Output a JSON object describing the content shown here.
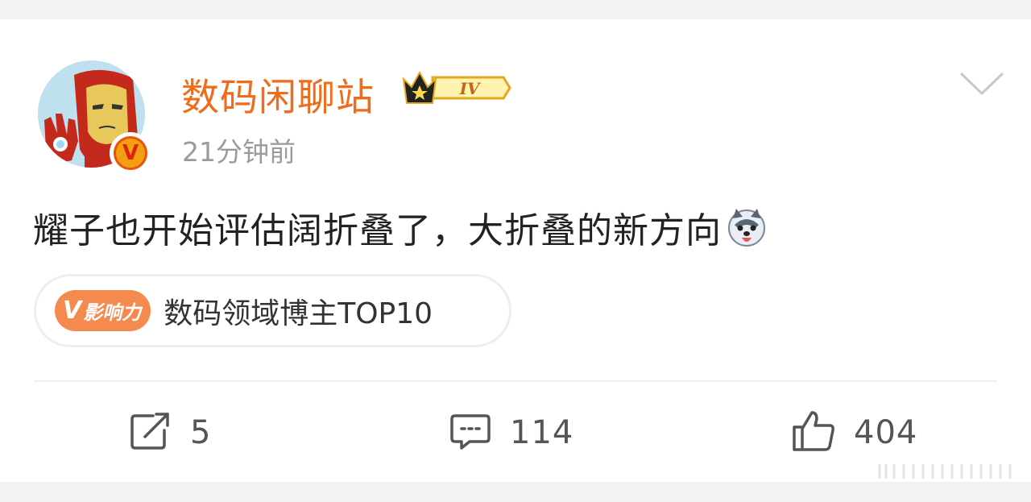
{
  "post": {
    "username": "数码闲聊站",
    "level": "IV",
    "timestamp": "21分钟前",
    "content": "耀子也开始评估阔折叠了，大折叠的新方向",
    "verified_mark": "V"
  },
  "influence": {
    "badge_letter": "V",
    "badge_text": "影响力",
    "label": "数码领域博主TOP10"
  },
  "actions": {
    "repost_count": "5",
    "comment_count": "114",
    "like_count": "404"
  },
  "icons": {
    "menu": "chevron-down-icon",
    "repost": "share-icon",
    "comment": "comment-icon",
    "like": "thumbs-up-icon",
    "emoji": "husky-emoji"
  },
  "colors": {
    "username": "#f06b1a",
    "badge": "#f58a4e",
    "text": "#222222",
    "muted": "#9b9b9b"
  }
}
